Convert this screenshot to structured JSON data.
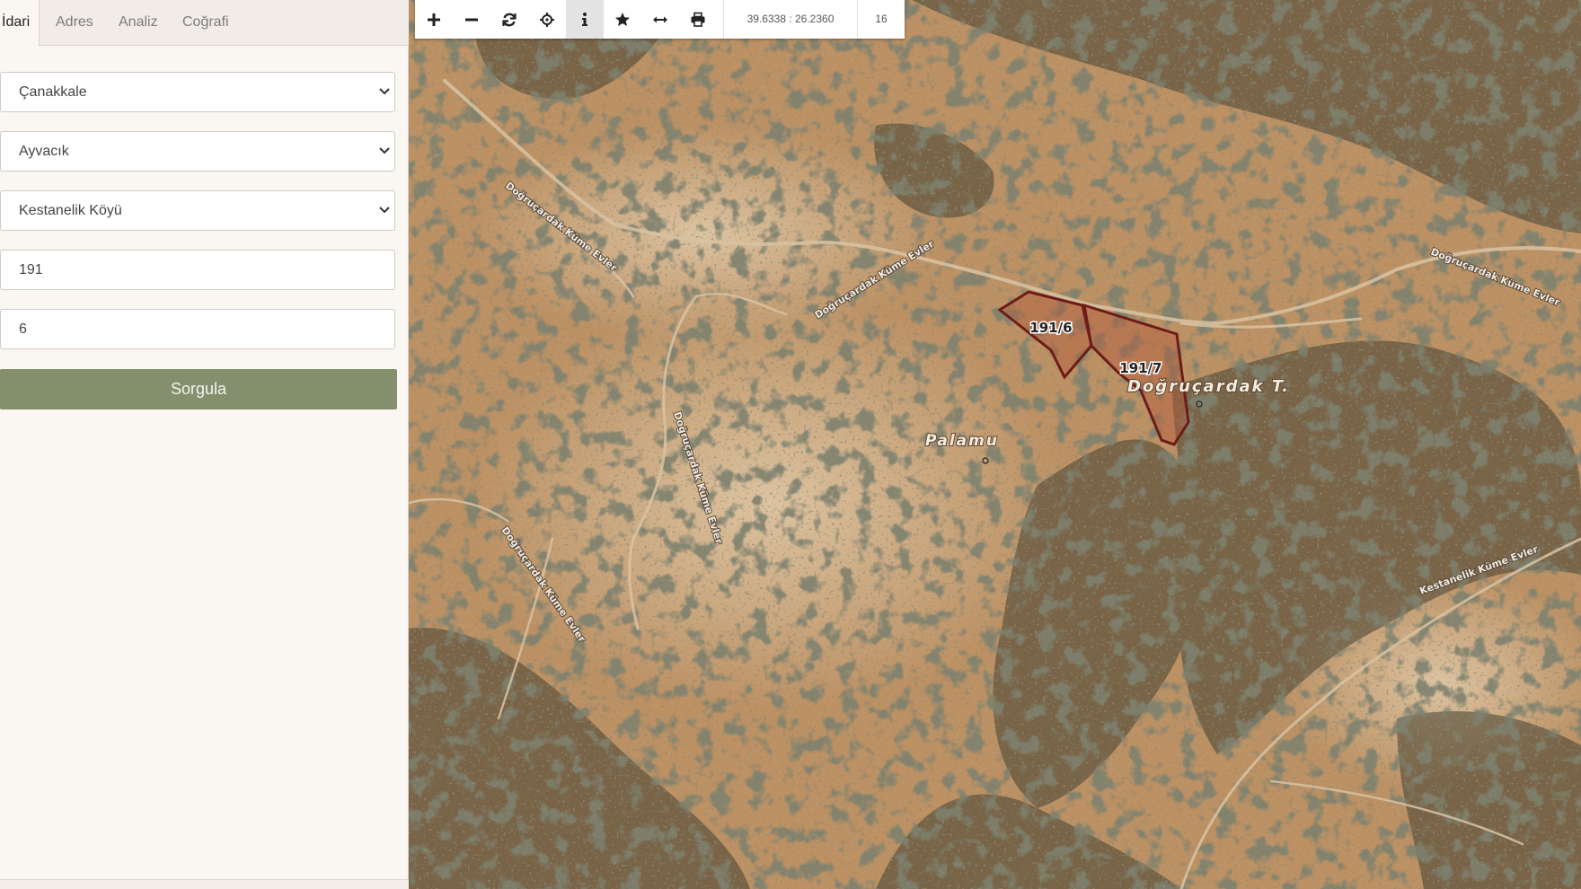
{
  "tabs": [
    {
      "label": "İdari",
      "active": true
    },
    {
      "label": "Adres",
      "active": false
    },
    {
      "label": "Analiz",
      "active": false
    },
    {
      "label": "Coğrafi",
      "active": false
    }
  ],
  "form": {
    "province": "Çanakkale",
    "district": "Ayvacık",
    "neighborhood": "Kestanelik Köyü",
    "block": "191",
    "parcel": "6",
    "submit_label": "Sorgula",
    "submit_color": "#848f6d"
  },
  "toolbar": {
    "tools": [
      "zoom-in-icon",
      "zoom-out-icon",
      "refresh-icon",
      "locate-icon",
      "info-icon",
      "star-icon",
      "measure-icon",
      "print-icon"
    ],
    "active_tool": "info-icon",
    "coordinates": "39.6338 : 26.2360",
    "zoom_level": "16"
  },
  "map": {
    "parcels": [
      {
        "label": "191/6",
        "fill": "#b45a3c",
        "stroke": "#6e1c18"
      },
      {
        "label": "191/7",
        "fill": "#b45a3c",
        "stroke": "#6e1c18"
      }
    ],
    "place_labels": {
      "peak": "Doğruçardak T.",
      "place": "Palamu"
    },
    "road_labels": {
      "r1": "Doğruçardak Küme Evler",
      "r2": "Doğruçardak Küme Evler",
      "r3": "Doğruçardak Küme Evler",
      "r4": "Doğruçardak Küme Evler",
      "r5": "Doğruçardak Küme Evler",
      "r6": "Kestanelik Küme Evler"
    }
  }
}
